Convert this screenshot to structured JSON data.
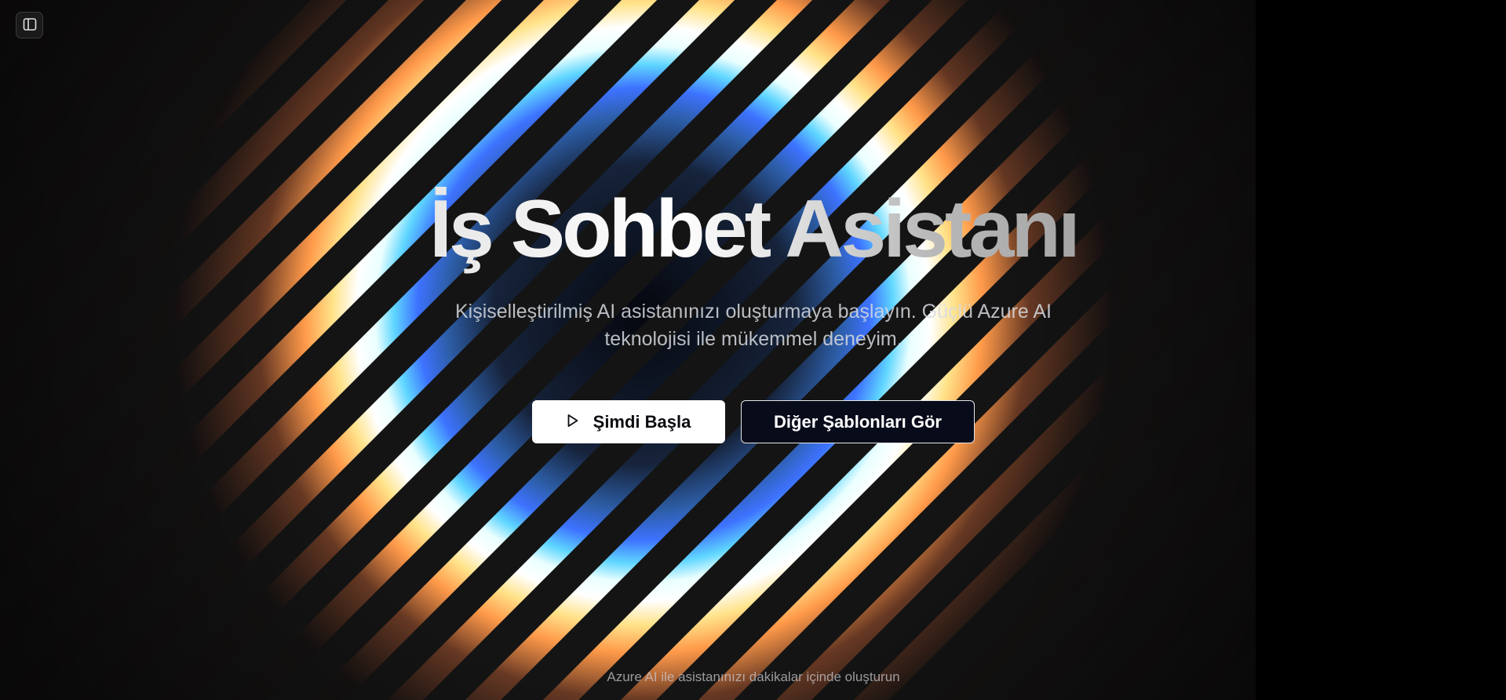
{
  "hero": {
    "title": "İş Sohbet Asistanı",
    "subtitle_line1": "Kişiselleştirilmiş AI asistanınızı oluşturmaya başlayın. Güçlü Azure AI",
    "subtitle_line2": "teknolojisi ile mükemmel deneyim.",
    "primary_button": "Şimdi Başla",
    "secondary_button": "Diğer Şablonları Gör"
  },
  "footer": {
    "text": "Azure AI ile asistanınızı dakikalar içinde oluşturun"
  },
  "icons": {
    "sidebar_toggle": "sidebar-panel-icon",
    "play": "play-icon"
  },
  "colors": {
    "background": "#121212",
    "glow_warm": "#ff9a4a",
    "glow_cool": "#3fa6ff",
    "button_primary": "#ffffff",
    "button_secondary": "#070b1a"
  }
}
